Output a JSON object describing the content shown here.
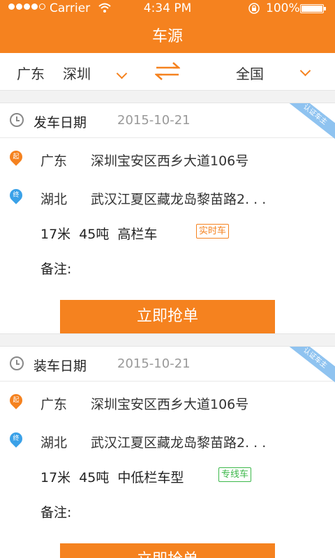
{
  "status_bar": {
    "carrier": "Carrier",
    "time": "4:34 PM",
    "battery": "100%",
    "battery_level": 1.0
  },
  "nav": {
    "title": "车源"
  },
  "filter": {
    "from_province": "广东",
    "from_city": "深圳",
    "to": "全国"
  },
  "cards": [
    {
      "ribbon": "认证车主",
      "date_label": "发车日期",
      "date": "2015-10-21",
      "start_badge": "起",
      "start_province": "广东",
      "start_address": "深圳宝安区西乡大道106号",
      "end_badge": "终",
      "end_province": "湖北",
      "end_address": "武汉江夏区藏龙岛黎苗路2. . .",
      "length": "17米",
      "weight": "45吨",
      "vehicle_type": "高栏车",
      "tag": "实时车",
      "remark_label": "备注:",
      "button": "立即抢单"
    },
    {
      "ribbon": "认证车主",
      "date_label": "装车日期",
      "date": "2015-10-21",
      "start_badge": "起",
      "start_province": "广东",
      "start_address": "深圳宝安区西乡大道106号",
      "end_badge": "终",
      "end_province": "湖北",
      "end_address": "武汉江夏区藏龙岛黎苗路2. . .",
      "length": "17米",
      "weight": "45吨",
      "vehicle_type": "中低栏车型",
      "tag": "专线车",
      "remark_label": "备注:",
      "button": "立即抢单"
    }
  ],
  "colors": {
    "accent": "#f5821f",
    "blue": "#3aa1e8",
    "green": "#3cb84a"
  }
}
